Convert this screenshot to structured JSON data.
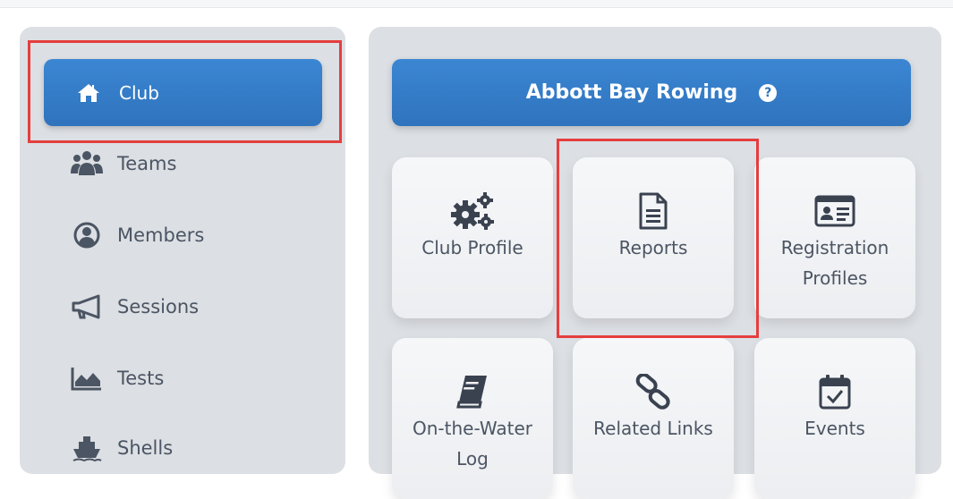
{
  "sidebar": {
    "items": [
      {
        "label": "Club",
        "icon": "home-icon",
        "active": true
      },
      {
        "label": "Teams",
        "icon": "users-icon"
      },
      {
        "label": "Members",
        "icon": "user-circle-icon"
      },
      {
        "label": "Sessions",
        "icon": "megaphone-icon"
      },
      {
        "label": "Tests",
        "icon": "area-chart-icon"
      },
      {
        "label": "Shells",
        "icon": "boat-icon"
      }
    ]
  },
  "main": {
    "club_name": "Abbott Bay Rowing",
    "help_glyph": "?",
    "tiles": [
      {
        "label": "Club Profile",
        "icon": "gears-icon"
      },
      {
        "label": "Reports",
        "icon": "document-icon"
      },
      {
        "label": "Registration Profiles",
        "icon": "id-card-icon"
      },
      {
        "label": "On-the-Water Log",
        "icon": "book-icon"
      },
      {
        "label": "Related Links",
        "icon": "link-icon"
      },
      {
        "label": "Events",
        "icon": "calendar-check-icon"
      }
    ]
  },
  "colors": {
    "primary": "#2f73bd",
    "panel_bg": "#dcdfe3",
    "highlight": "#e53e3e",
    "text": "#4b5563"
  }
}
